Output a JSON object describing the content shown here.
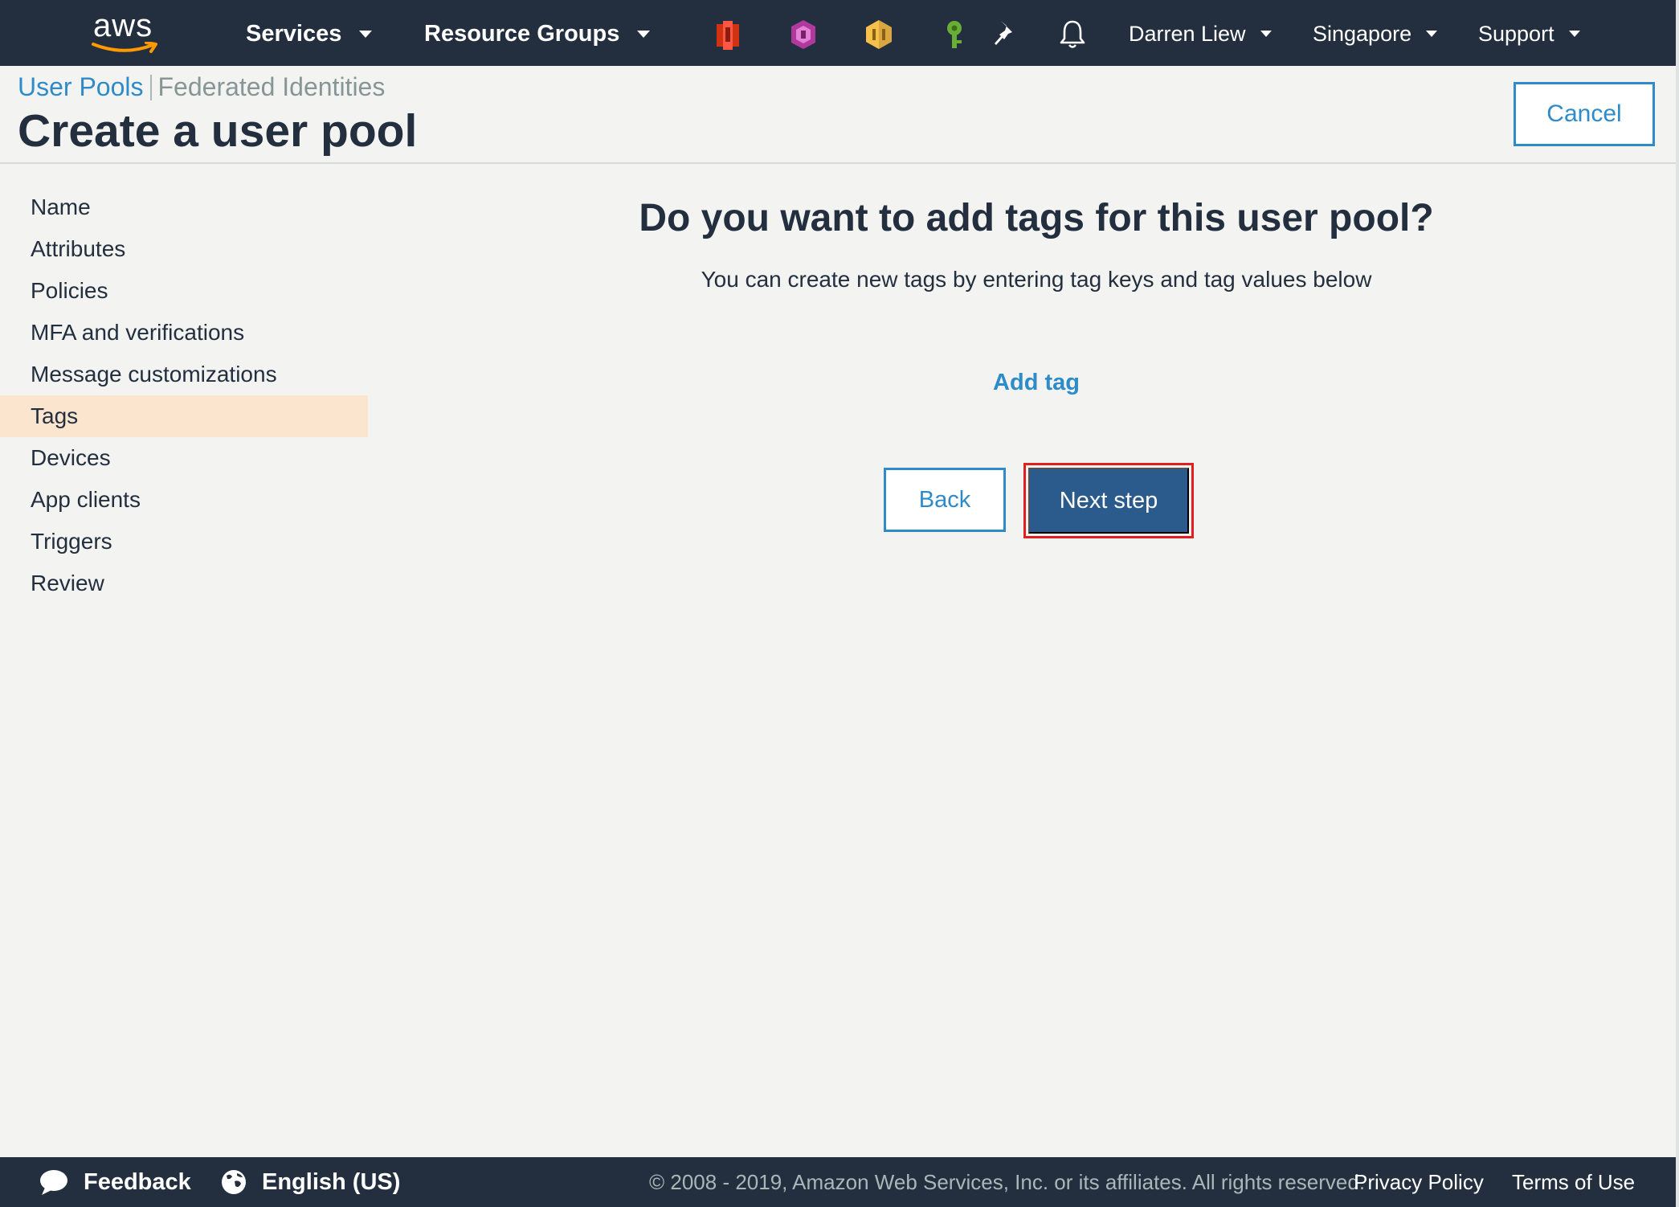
{
  "topnav": {
    "logo_text": "aws",
    "services_label": "Services",
    "resource_groups_label": "Resource Groups",
    "shortcut_icons": [
      "service-shortcut-1-icon",
      "service-shortcut-2-icon",
      "service-shortcut-3-icon",
      "service-shortcut-4-icon"
    ],
    "user_label": "Darren Liew",
    "region_label": "Singapore",
    "support_label": "Support"
  },
  "header": {
    "breadcrumb_active": "User Pools",
    "breadcrumb_inactive": "Federated Identities",
    "title": "Create a user pool",
    "cancel_label": "Cancel"
  },
  "sidebar": {
    "items": [
      {
        "label": "Name"
      },
      {
        "label": "Attributes"
      },
      {
        "label": "Policies"
      },
      {
        "label": "MFA and verifications"
      },
      {
        "label": "Message customizations"
      },
      {
        "label": "Tags",
        "active": true
      },
      {
        "label": "Devices"
      },
      {
        "label": "App clients"
      },
      {
        "label": "Triggers"
      },
      {
        "label": "Review"
      }
    ]
  },
  "main": {
    "question": "Do you want to add tags for this user pool?",
    "subtitle": "You can create new tags by entering tag keys and tag values below",
    "add_tag_label": "Add tag",
    "back_label": "Back",
    "next_label": "Next step"
  },
  "footer": {
    "feedback_label": "Feedback",
    "language_label": "English (US)",
    "copyright": "© 2008 - 2019, Amazon Web Services, Inc. or its affiliates. All rights reserved.",
    "privacy_label": "Privacy Policy",
    "terms_label": "Terms of Use"
  },
  "colors": {
    "nav_bg": "#232f3e",
    "link": "#2e8bc9",
    "primary_button": "#2b5a8c",
    "active_sidebar": "#fbe5cf",
    "highlight_border": "#e02020"
  }
}
